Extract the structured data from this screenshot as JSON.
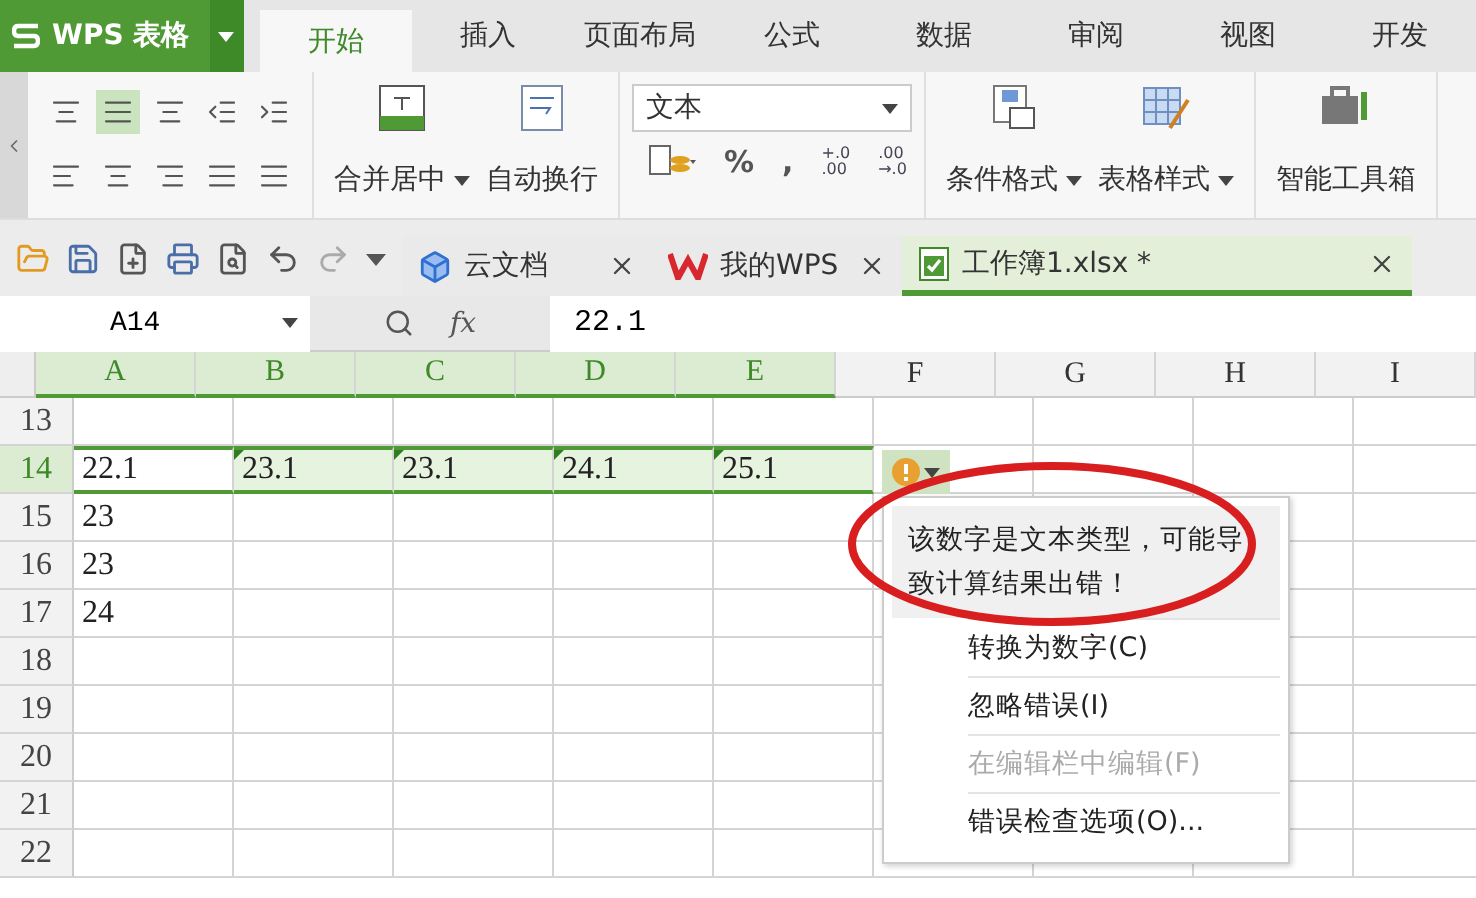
{
  "app": {
    "name": "WPS 表格"
  },
  "menu_tabs": [
    {
      "label": "开始",
      "selected": true
    },
    {
      "label": "插入",
      "selected": false
    },
    {
      "label": "页面布局",
      "selected": false
    },
    {
      "label": "公式",
      "selected": false
    },
    {
      "label": "数据",
      "selected": false
    },
    {
      "label": "审阅",
      "selected": false
    },
    {
      "label": "视图",
      "selected": false
    },
    {
      "label": "开发",
      "selected": false
    }
  ],
  "ribbon": {
    "center_align_selected": true,
    "merge_button": "合并居中",
    "wrap_button": "自动换行",
    "number_format": "文本",
    "percent": "%",
    "comma": ",",
    "increase_decimal": {
      "top": "+.0",
      "bottom": ".00"
    },
    "decrease_decimal": {
      "top": ".00",
      "bottom": "→.0"
    },
    "conditional_format": "条件格式",
    "table_style": "表格样式",
    "toolbox": "智能工具箱"
  },
  "doc_tabs": [
    {
      "label": "云文档",
      "kind": "cloud",
      "selected": false
    },
    {
      "label": "我的WPS",
      "kind": "wps",
      "selected": false
    },
    {
      "label": "工作簿1.xlsx *",
      "kind": "sheet",
      "selected": true
    }
  ],
  "formula_bar": {
    "cell_ref": "A14",
    "fx": "fx",
    "value": "22.1"
  },
  "columns": [
    {
      "label": "A",
      "selected": true
    },
    {
      "label": "B",
      "selected": true
    },
    {
      "label": "C",
      "selected": true
    },
    {
      "label": "D",
      "selected": true
    },
    {
      "label": "E",
      "selected": true
    },
    {
      "label": "F",
      "selected": false
    },
    {
      "label": "G",
      "selected": false
    },
    {
      "label": "H",
      "selected": false
    },
    {
      "label": "I",
      "selected": false
    }
  ],
  "rows": [
    {
      "number": "13",
      "selected": false
    },
    {
      "number": "14",
      "selected": true,
      "cells": [
        {
          "text": "22.1",
          "error_flag": false,
          "active": true
        },
        {
          "text": "23.1",
          "error_flag": true,
          "active": false
        },
        {
          "text": "23.1",
          "error_flag": true,
          "active": false
        },
        {
          "text": "24.1",
          "error_flag": true,
          "active": false
        },
        {
          "text": "25.1",
          "error_flag": true,
          "active": false
        }
      ]
    },
    {
      "number": "15",
      "selected": false,
      "cells": [
        {
          "text": "23",
          "error_flag": false,
          "active": false
        }
      ]
    },
    {
      "number": "16",
      "selected": false,
      "cells": [
        {
          "text": "23",
          "error_flag": false,
          "active": false
        }
      ]
    },
    {
      "number": "17",
      "selected": false,
      "cells": [
        {
          "text": "24",
          "error_flag": false,
          "active": false
        }
      ]
    },
    {
      "number": "18",
      "selected": false
    },
    {
      "number": "19",
      "selected": false
    },
    {
      "number": "20",
      "selected": false
    },
    {
      "number": "21",
      "selected": false
    },
    {
      "number": "22",
      "selected": false
    }
  ],
  "error_popup": {
    "message": "该数字是文本类型，可能导致计算结果出错！",
    "items": [
      {
        "label": "转换为数字(C)",
        "disabled": false
      },
      {
        "label": "忽略错误(I)",
        "disabled": false
      },
      {
        "label": "在编辑栏中编辑(F)",
        "disabled": true
      },
      {
        "label": "错误检查选项(O)...",
        "disabled": false
      }
    ]
  }
}
